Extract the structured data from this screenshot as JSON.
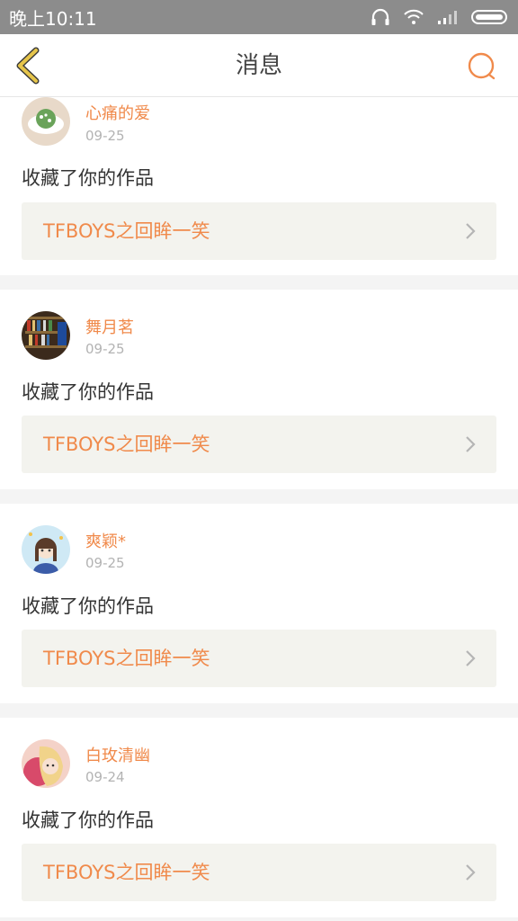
{
  "status_bar": {
    "time": "晚上10:11",
    "icons": [
      "headphones-icon",
      "wifi-icon",
      "signal-icon",
      "battery-icon"
    ]
  },
  "header": {
    "title": "消息",
    "back_icon": "chevron-left-icon",
    "search_icon": "search-icon"
  },
  "colors": {
    "accent": "#f08a4b",
    "back_arrow": "#e6c54b",
    "status_bar_bg": "#8c8c8c",
    "link_bg": "#f3f3ee"
  },
  "notifications": [
    {
      "user": "心痛的爱",
      "date": "09-25",
      "action": "收藏了你的作品",
      "work": "TFBOYS之回眸一笑"
    },
    {
      "user": "舞月茗",
      "date": "09-25",
      "action": "收藏了你的作品",
      "work": "TFBOYS之回眸一笑"
    },
    {
      "user": "爽颖*",
      "date": "09-25",
      "action": "收藏了你的作品",
      "work": "TFBOYS之回眸一笑"
    },
    {
      "user": "白玫清幽",
      "date": "09-24",
      "action": "收藏了你的作品",
      "work": "TFBOYS之回眸一笑"
    }
  ]
}
